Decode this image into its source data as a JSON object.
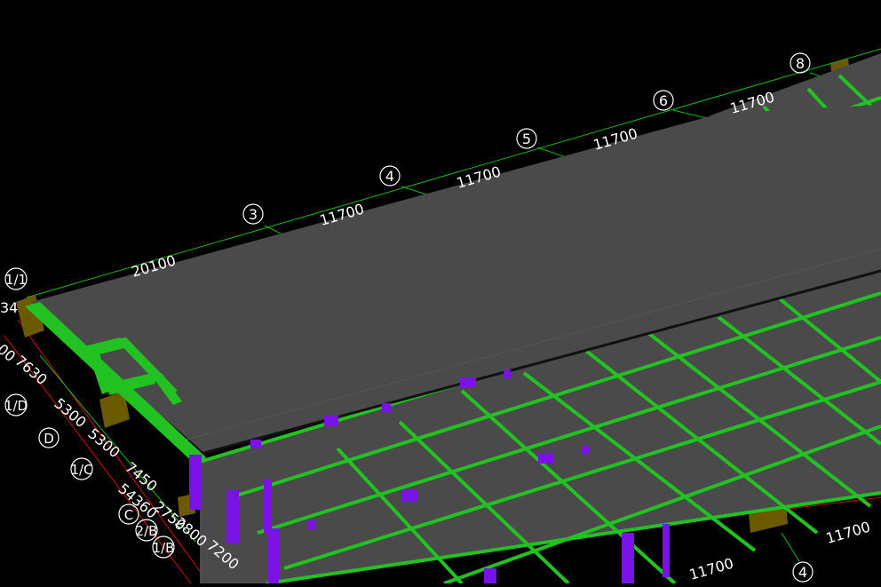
{
  "viewport": {
    "background": "#000000"
  },
  "colors": {
    "slab": "#4a4a4a",
    "slab_edge": "#3a3a3a",
    "beam": "#22c222",
    "column": "#7a12e6",
    "footing": "#6b5a00",
    "axis_line": "#18b818",
    "redline": "#d01010",
    "label": "#ffffff"
  },
  "top_axes": {
    "bubbles": [
      "3",
      "4",
      "5",
      "6",
      "8"
    ],
    "dimensions": [
      "20100",
      "11700",
      "11700",
      "11700",
      "11700"
    ]
  },
  "left_axes": {
    "bubbles": [
      "1/1",
      "1/D",
      "D",
      "1/C",
      "C",
      "2/B",
      "1/B"
    ],
    "dimensions": [
      "34",
      "00",
      "7630",
      "5300",
      "5300",
      "7450",
      "54360",
      "2750",
      "2800",
      "7200"
    ]
  },
  "bottom_axes": {
    "bubbles": [
      "4"
    ],
    "dimensions": [
      "11700",
      "11700"
    ]
  }
}
